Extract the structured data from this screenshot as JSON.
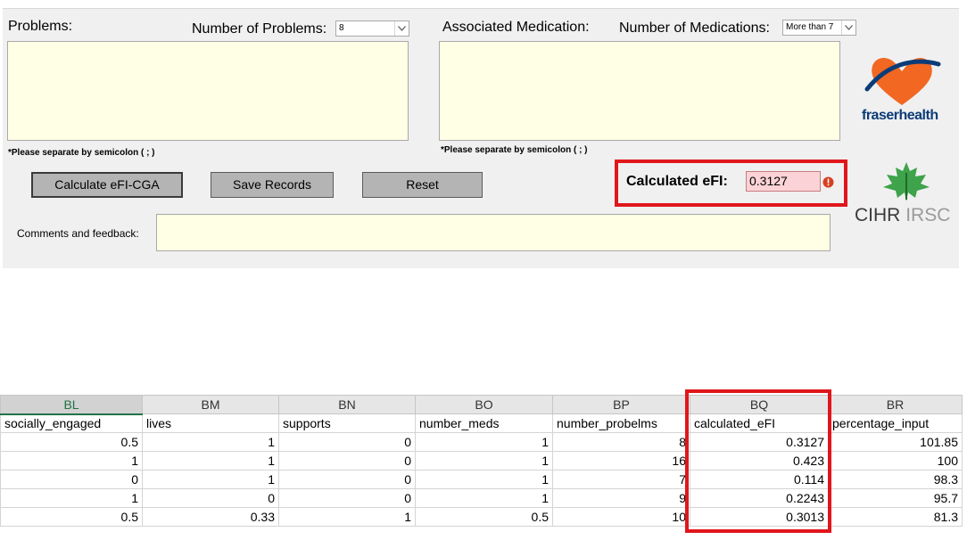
{
  "form": {
    "problems_label": "Problems:",
    "num_problems_label": "Number of Problems:",
    "num_problems_value": "8",
    "problems_note": "*Please separate by semicolon ( ; )",
    "medication_label": "Associated Medication:",
    "num_medications_label": "Number of Medications:",
    "num_medications_value": "More than 7",
    "medication_note": "*Please separate by semicolon ( ; )",
    "calculate_button": "Calculate eFI-CGA",
    "save_button": "Save Records",
    "reset_button": "Reset",
    "efi_label": "Calculated eFI:",
    "efi_value": "0.3127",
    "comments_label": "Comments and feedback:",
    "brand_fraser_a": "fraser",
    "brand_fraser_b": "health",
    "brand_cihr": "CIHR",
    "brand_irsc": "IRSC",
    "colors": {
      "panel_bg": "#f0f0f0",
      "field_bg": "#ffffe6",
      "highlight": "#e0161b",
      "efi_bg": "#fbd3d6"
    }
  },
  "sheet": {
    "columns": [
      "BL",
      "BM",
      "BN",
      "BO",
      "BP",
      "BQ",
      "BR"
    ],
    "headers": [
      "socially_engaged",
      "lives",
      "supports",
      "number_meds",
      "number_probelms",
      "calculated_eFI",
      "percentage_input"
    ],
    "rows": [
      [
        "0.5",
        "1",
        "0",
        "1",
        "8",
        "0.3127",
        "101.85"
      ],
      [
        "1",
        "1",
        "0",
        "1",
        "16",
        "0.423",
        "100"
      ],
      [
        "0",
        "1",
        "0",
        "1",
        "7",
        "0.114",
        "98.3"
      ],
      [
        "1",
        "0",
        "0",
        "1",
        "9",
        "0.2243",
        "95.7"
      ],
      [
        "0.5",
        "0.33",
        "1",
        "0.5",
        "10",
        "0.3013",
        "81.3"
      ]
    ]
  }
}
